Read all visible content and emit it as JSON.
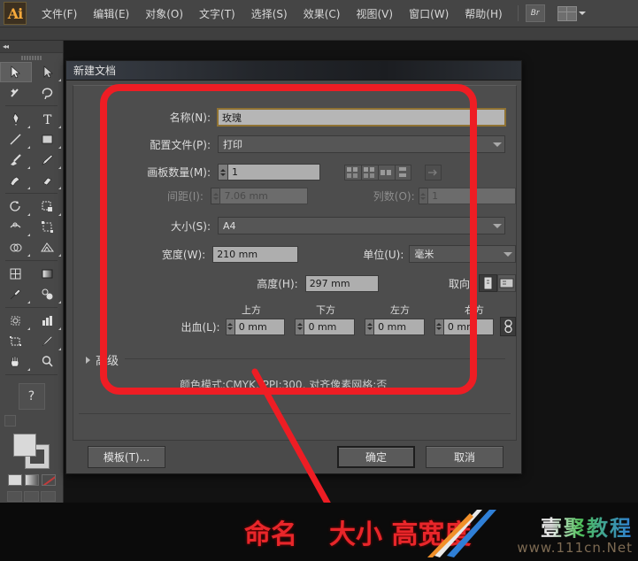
{
  "app": {
    "logo": "Ai",
    "menus": [
      {
        "label": "文件(F)"
      },
      {
        "label": "编辑(E)"
      },
      {
        "label": "对象(O)"
      },
      {
        "label": "文字(T)"
      },
      {
        "label": "选择(S)"
      },
      {
        "label": "效果(C)"
      },
      {
        "label": "视图(V)"
      },
      {
        "label": "窗口(W)"
      },
      {
        "label": "帮助(H)"
      }
    ],
    "bridge_label": "Br"
  },
  "dialog": {
    "title": "新建文档",
    "name": {
      "label": "名称(N):",
      "value": "玫瑰"
    },
    "profile": {
      "label": "配置文件(P):",
      "value": "打印"
    },
    "artboards": {
      "label": "画板数量(M):",
      "value": "1"
    },
    "spacing": {
      "label": "间距(I):",
      "value": "7.06 mm"
    },
    "columns": {
      "label": "列数(O):",
      "value": "1"
    },
    "size": {
      "label": "大小(S):",
      "value": "A4"
    },
    "width": {
      "label": "宽度(W):",
      "value": "210 mm"
    },
    "height": {
      "label": "高度(H):",
      "value": "297 mm"
    },
    "units": {
      "label": "单位(U):",
      "value": "毫米"
    },
    "orientation": {
      "label": "取向:",
      "portrait_icon": "portrait-icon",
      "landscape_icon": "landscape-icon"
    },
    "bleed": {
      "label": "出血(L):",
      "top_label": "上方",
      "bottom_label": "下方",
      "left_label": "左方",
      "right_label": "右方",
      "top": "0 mm",
      "bottom": "0 mm",
      "left": "0 mm",
      "right": "0 mm",
      "link_icon": "link-chain-icon"
    },
    "advanced": {
      "label": "高级",
      "summary": "颜色模式:CMYK, PPI:300, 对齐像素网格:否"
    },
    "buttons": {
      "template": "模板(T)...",
      "ok": "确定",
      "cancel": "取消"
    }
  },
  "annotation": {
    "color": "#ee1d24",
    "captions": [
      "命名",
      "大小 高宽度"
    ]
  },
  "watermark": {
    "name": "壹聚教程",
    "url": "www.111cn.Net"
  }
}
